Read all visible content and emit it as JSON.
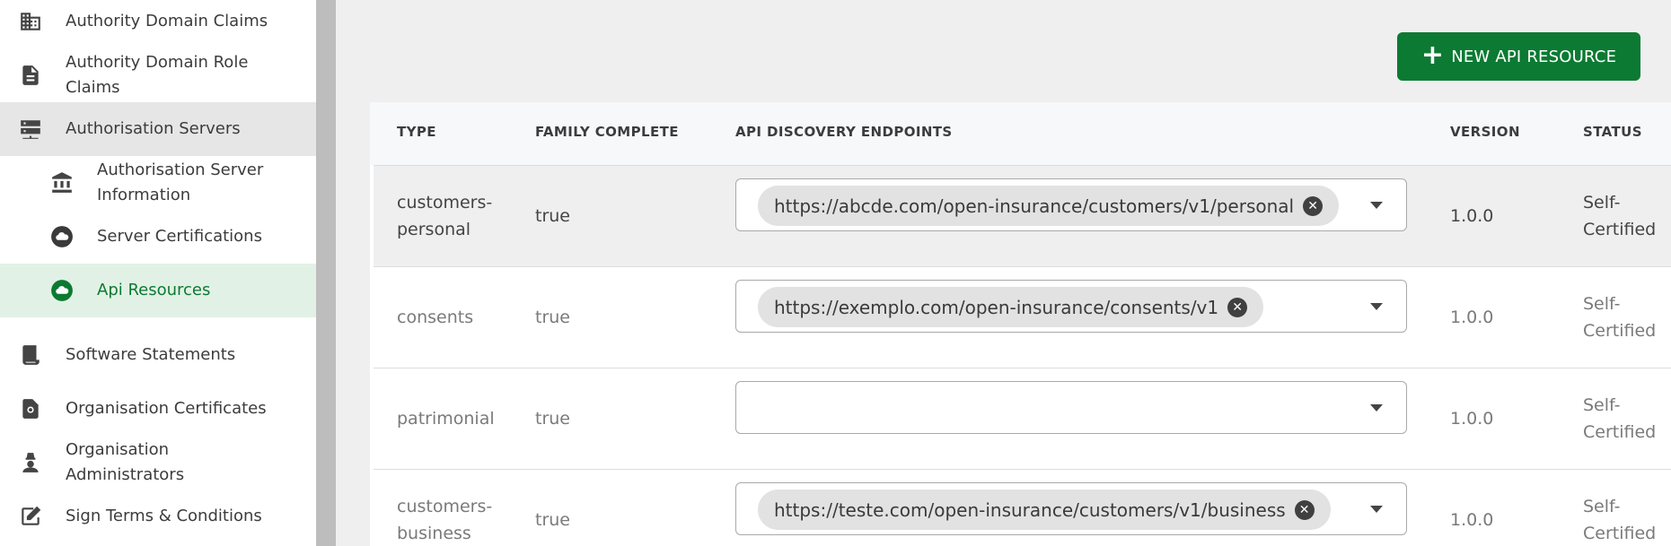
{
  "sidebar": {
    "items": [
      {
        "label": "Authority Domain Claims",
        "icon": "building-icon"
      },
      {
        "label": "Authority Domain Role Claims",
        "icon": "document-icon"
      },
      {
        "label": "Authorisation Servers",
        "icon": "server-icon"
      },
      {
        "label": "Authorisation Server Information",
        "icon": "bank-icon"
      },
      {
        "label": "Server Certifications",
        "icon": "cloud-icon"
      },
      {
        "label": "Api Resources",
        "icon": "cloud-icon"
      },
      {
        "label": "Software Statements",
        "icon": "statement-icon"
      },
      {
        "label": "Organisation Certificates",
        "icon": "certificate-icon"
      },
      {
        "label": "Organisation Administrators",
        "icon": "admin-icon"
      },
      {
        "label": "Sign Terms & Conditions",
        "icon": "sign-icon"
      }
    ],
    "active_color": "#0c7a33"
  },
  "toolbar": {
    "new_button_plus": "+",
    "new_button_label": "NEW API RESOURCE"
  },
  "table": {
    "headers": [
      "TYPE",
      "FAMILY COMPLETE",
      "API DISCOVERY ENDPOINTS",
      "VERSION",
      "STATUS"
    ],
    "rows": [
      {
        "type": "customers-personal",
        "family_complete": "true",
        "endpoint": "https://abcde.com/open-insurance/customers/v1/personal",
        "version": "1.0.0",
        "status": "Self-Certified"
      },
      {
        "type": "consents",
        "family_complete": "true",
        "endpoint": "https://exemplo.com/open-insurance/consents/v1",
        "version": "1.0.0",
        "status": "Self-Certified"
      },
      {
        "type": "patrimonial",
        "family_complete": "true",
        "endpoint": "",
        "version": "1.0.0",
        "status": "Self-Certified"
      },
      {
        "type": "customers-business",
        "family_complete": "true",
        "endpoint": "https://teste.com/open-insurance/customers/v1/business",
        "version": "1.0.0",
        "status": "Self-Certified"
      }
    ]
  },
  "colors": {
    "primary": "#0c7a33",
    "active_bg": "#e2f1e5"
  }
}
